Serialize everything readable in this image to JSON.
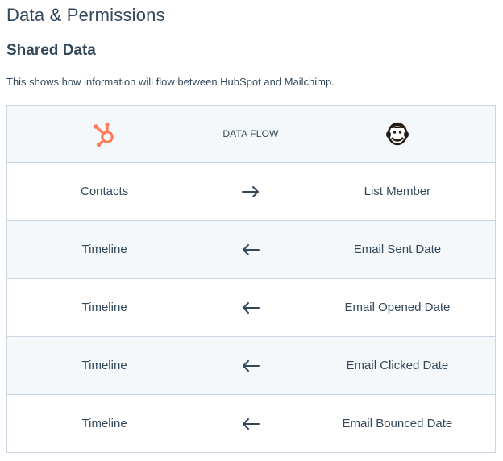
{
  "header": {
    "page_title": "Data & Permissions",
    "section_title": "Shared Data",
    "description": "This shows how information will flow between HubSpot and Mailchimp."
  },
  "table": {
    "columns": {
      "left_icon": "hubspot-logo-icon",
      "middle_label": "DATA FLOW",
      "right_icon": "mailchimp-logo-icon"
    },
    "rows": [
      {
        "left": "Contacts",
        "direction": "right",
        "right": "List Member"
      },
      {
        "left": "Timeline",
        "direction": "left",
        "right": "Email Sent Date"
      },
      {
        "left": "Timeline",
        "direction": "left",
        "right": "Email Opened Date"
      },
      {
        "left": "Timeline",
        "direction": "left",
        "right": "Email Clicked Date"
      },
      {
        "left": "Timeline",
        "direction": "left",
        "right": "Email Bounced Date"
      }
    ]
  },
  "colors": {
    "text": "#33475b",
    "border": "#cbd6e2",
    "alt_row": "#f5f8fa",
    "hubspot_orange": "#ff7a59"
  }
}
